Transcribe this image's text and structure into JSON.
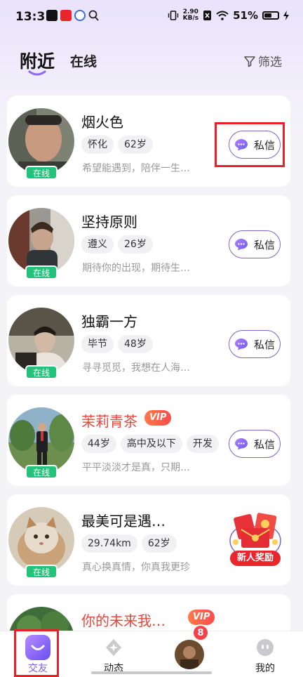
{
  "status_bar": {
    "time": "13:31",
    "net_speed_value": "2.90",
    "net_speed_unit": "KB/s",
    "battery": "51%"
  },
  "header": {
    "tab_active": "附近",
    "tab_other": "在线",
    "filter_label": "筛选"
  },
  "users": [
    {
      "name": "烟火色",
      "tags": [
        "怀化",
        "62岁"
      ],
      "intro": "希望能遇到，陪伴一生…",
      "status": "在线",
      "action": "私信"
    },
    {
      "name": "坚持原则",
      "tags": [
        "遵义",
        "26岁"
      ],
      "intro": "期待你的出现，期待生…",
      "status": "在线",
      "action": "私信"
    },
    {
      "name": "独霸一方",
      "tags": [
        "毕节",
        "48岁"
      ],
      "intro": "寻寻觅觅，我想在人海…",
      "status": "在线",
      "action": "私信"
    },
    {
      "name": "茉莉青茶",
      "vip": "VIP",
      "tags": [
        "44岁",
        "高中及以下",
        "开发"
      ],
      "intro": "平平淡淡才是真，只期…",
      "status": "在线",
      "action": "私信"
    },
    {
      "name": "最美可是遇…",
      "tags": [
        "29.74km",
        "62岁"
      ],
      "intro": "真心换真情，你真我更珍",
      "status": "在线",
      "action": "新人奖励"
    },
    {
      "name": "你的未来我…",
      "vip": "VIP"
    }
  ],
  "bottom_nav": {
    "items": [
      {
        "label": "交友",
        "icon": "smile-chat-icon",
        "active": true
      },
      {
        "label": "动态",
        "icon": "sparkle-icon"
      },
      {
        "label": "",
        "icon": "avatar-icon",
        "badge": "8"
      },
      {
        "label": "我的",
        "icon": "face-icon"
      }
    ]
  },
  "colors": {
    "accent": "#7a5ff0",
    "online_badge": "#23c27a",
    "vip_name": "#e8453c",
    "highlight": "#e8202a"
  }
}
